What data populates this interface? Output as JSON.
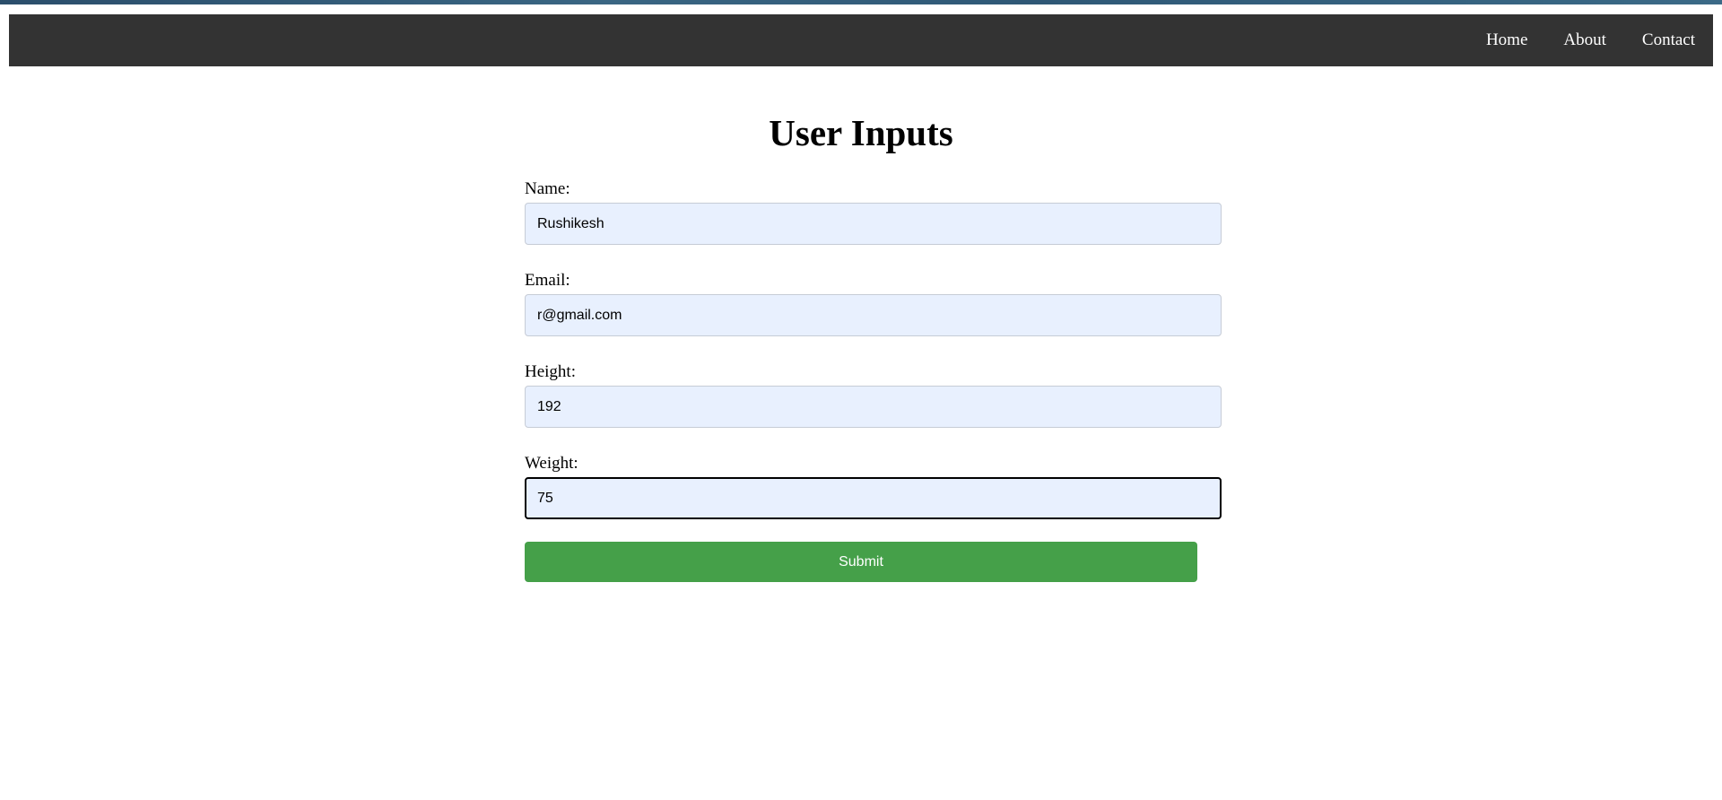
{
  "nav": {
    "items": [
      {
        "label": "Home"
      },
      {
        "label": "About"
      },
      {
        "label": "Contact"
      }
    ]
  },
  "page": {
    "title": "User Inputs"
  },
  "form": {
    "fields": [
      {
        "label": "Name:",
        "value": "Rushikesh"
      },
      {
        "label": "Email:",
        "value": "r@gmail.com"
      },
      {
        "label": "Height:",
        "value": "192"
      },
      {
        "label": "Weight:",
        "value": "75"
      }
    ],
    "submit_label": "Submit"
  },
  "colors": {
    "navbar_bg": "#333333",
    "input_bg": "#e8f0fe",
    "submit_bg": "#45a049"
  }
}
